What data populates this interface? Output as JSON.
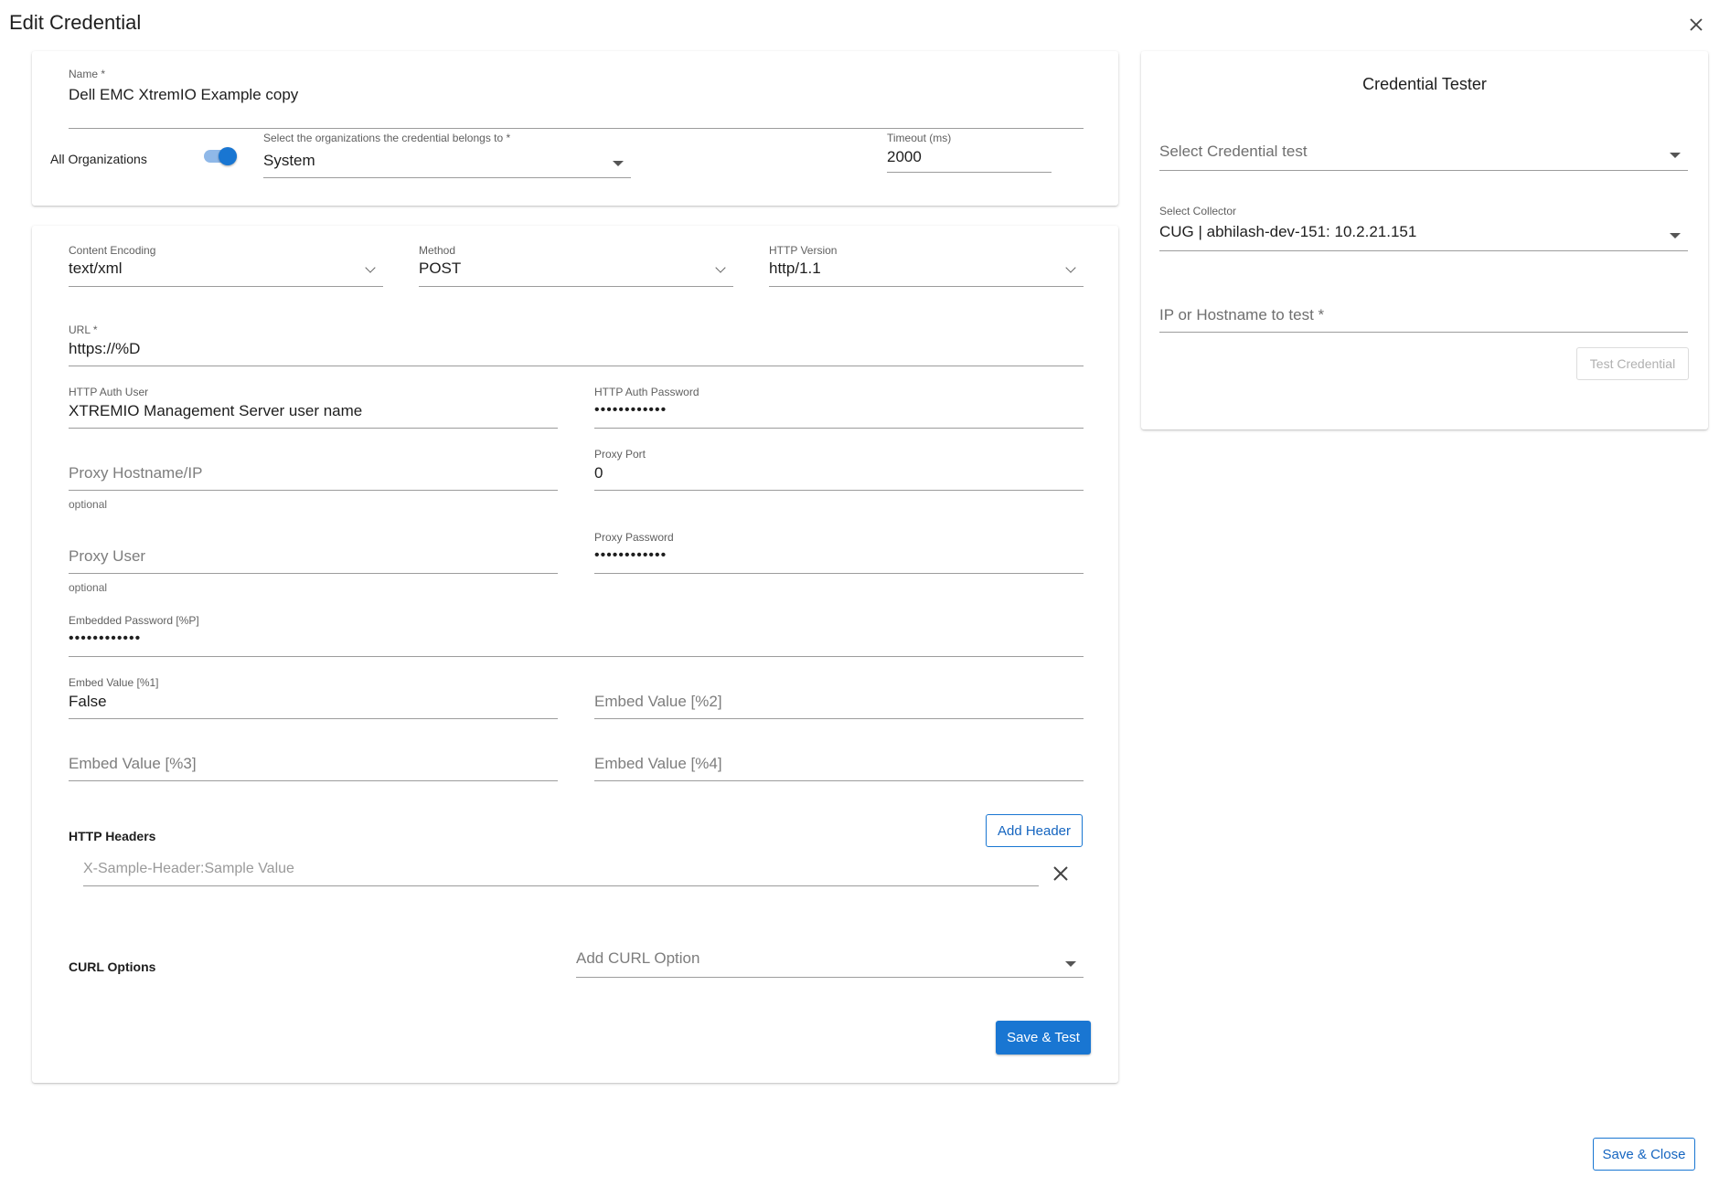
{
  "dialog": {
    "title": "Edit Credential"
  },
  "general": {
    "name_label": "Name",
    "name_value": "Dell EMC XtremIO Example copy",
    "all_orgs_label": "All Organizations",
    "all_orgs_enabled": true,
    "orgs_label": "Select the organizations the credential belongs to",
    "orgs_value": "System",
    "timeout_label": "Timeout (ms)",
    "timeout_value": "2000"
  },
  "request": {
    "encoding_label": "Content Encoding",
    "encoding_value": "text/xml",
    "method_label": "Method",
    "method_value": "POST",
    "http_version_label": "HTTP Version",
    "http_version_value": "http/1.1",
    "url_label": "URL",
    "url_value": "https://%D",
    "auth_user_label": "HTTP Auth User",
    "auth_user_value": "XTREMIO Management Server user name",
    "auth_password_label": "HTTP Auth Password",
    "auth_password_value": "••••••••••••",
    "proxy_host_placeholder": "Proxy Hostname/IP",
    "proxy_host_helper": "optional",
    "proxy_port_label": "Proxy Port",
    "proxy_port_value": "0",
    "proxy_user_placeholder": "Proxy User",
    "proxy_user_helper": "optional",
    "proxy_password_label": "Proxy Password",
    "proxy_password_value": "••••••••••••",
    "embedded_password_label": "Embedded Password [%P]",
    "embedded_password_value": "••••••••••••",
    "embed1_label": "Embed Value [%1]",
    "embed1_value": "False",
    "embed2_placeholder": "Embed Value [%2]",
    "embed3_placeholder": "Embed Value [%3]",
    "embed4_placeholder": "Embed Value [%4]",
    "http_headers_label": "HTTP Headers",
    "add_header_label": "Add Header",
    "header_placeholder": "X-Sample-Header:Sample Value",
    "curl_options_label": "CURL Options",
    "curl_placeholder": "Add CURL Option",
    "save_test_label": "Save & Test"
  },
  "tester": {
    "title": "Credential Tester",
    "test_placeholder": "Select Credential test",
    "collector_label": "Select Collector",
    "collector_value": "CUG | abhilash-dev-151: 10.2.21.151",
    "ip_placeholder": "IP or Hostname to test",
    "test_button_label": "Test Credential"
  },
  "footer": {
    "save_close_label": "Save & Close"
  },
  "colors": {
    "accent": "#1976d2",
    "toggle_track": "#8fb8e8"
  },
  "icons": {
    "close": "close-icon",
    "remove_header": "close-icon",
    "dropdown": "caret-down-icon",
    "select": "chevron-down-icon"
  }
}
